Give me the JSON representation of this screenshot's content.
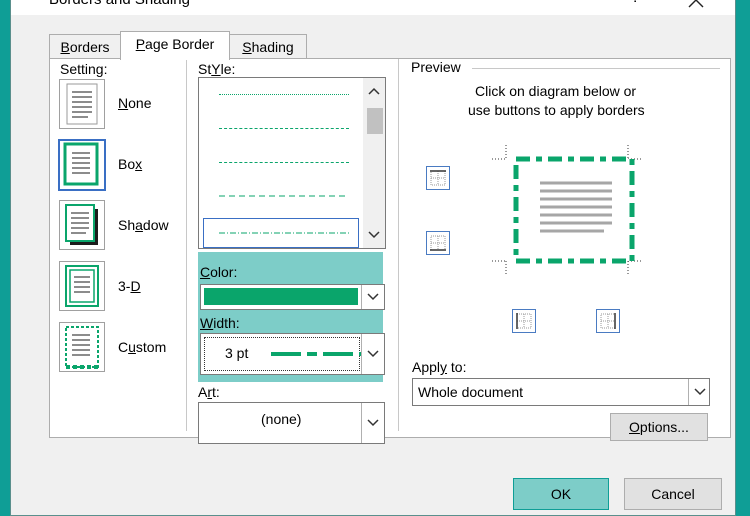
{
  "dialog": {
    "title": "Borders and Shading",
    "help": "?",
    "tabs": {
      "borders_pre": "",
      "borders_key": "B",
      "borders_post": "orders",
      "page_pre": "",
      "page_key": "P",
      "page_post": "age Border",
      "shading_pre": "",
      "shading_key": "S",
      "shading_post": "hading"
    }
  },
  "setting": {
    "heading": "Setting:",
    "items": [
      {
        "key": "N",
        "post": "one"
      },
      {
        "pre": "Bo",
        "key": "x",
        "post": ""
      },
      {
        "pre": "Sh",
        "key": "a",
        "post": "dow"
      },
      {
        "pre": "3-",
        "key": "D",
        "post": ""
      },
      {
        "pre": "C",
        "key": "u",
        "post": "stom"
      }
    ]
  },
  "style": {
    "heading_key": "Y",
    "heading_pre": "St",
    "heading_post": "le:"
  },
  "color": {
    "heading_key": "C",
    "heading_post": "olor:",
    "value": "#0aa56b"
  },
  "width": {
    "heading_key": "W",
    "heading_post": "idth:",
    "value": "3 pt"
  },
  "art": {
    "heading_pre": "A",
    "heading_key": "r",
    "heading_post": "t:",
    "value": "(none)"
  },
  "preview": {
    "heading": "Preview",
    "hint1": "Click on diagram below or",
    "hint2": "use buttons to apply borders",
    "border_color": "#0aa56b"
  },
  "apply": {
    "heading_pre": "Appl",
    "heading_key": "y",
    "heading_post": " to:",
    "value": "Whole document"
  },
  "buttons": {
    "options_key": "O",
    "options_post": "ptions...",
    "ok": "OK",
    "cancel": "Cancel"
  },
  "colors": {
    "accent": "#0f9e96",
    "highlight": "#7dcdc8",
    "selection": "#3a6fc4"
  }
}
